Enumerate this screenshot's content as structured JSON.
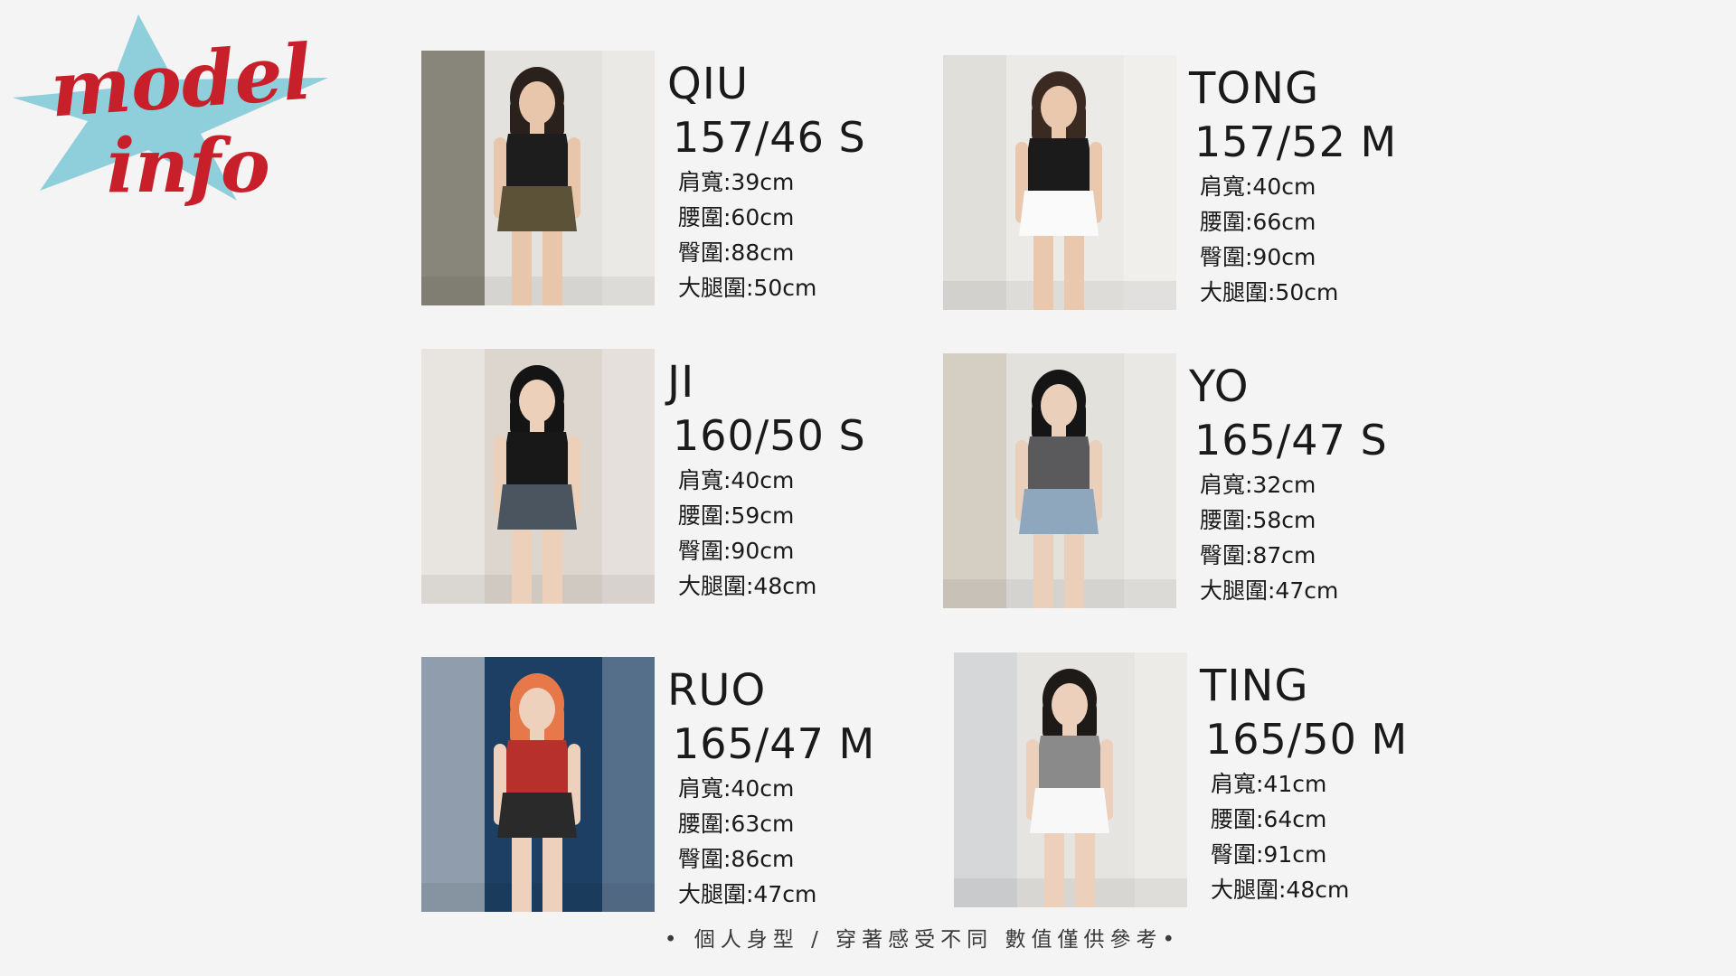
{
  "logo": {
    "line1": "model",
    "line2": "info",
    "star_color": "#8fcfdc",
    "text_color": "#c7202a"
  },
  "models": [
    {
      "name": "QIU",
      "size": "157/46 S",
      "measurements": [
        "肩寬:39cm",
        "腰圍:60cm",
        "臀圍:88cm",
        "大腿圍:50cm"
      ],
      "photo_palette": {
        "wall": "#e4e2de",
        "top": "#1d1d1d",
        "bottom": "#5b5238",
        "accent": "#3c3a2a",
        "hair": "#2a211c",
        "skin": "#e8c6ac"
      }
    },
    {
      "name": "TONG",
      "size": "157/52 M",
      "measurements": [
        "肩寬:40cm",
        "腰圍:66cm",
        "臀圍:90cm",
        "大腿圍:50cm"
      ],
      "photo_palette": {
        "wall": "#eceae6",
        "top": "#1b1b1b",
        "bottom": "#fafafa",
        "accent": "#d9d6d0",
        "hair": "#3a2a22",
        "skin": "#e9c8ae"
      }
    },
    {
      "name": "JI",
      "size": "160/50 S",
      "measurements": [
        "肩寬:40cm",
        "腰圍:59cm",
        "臀圍:90cm",
        "大腿圍:48cm"
      ],
      "photo_palette": {
        "wall": "#dcd6cf",
        "top": "#181818",
        "bottom": "#4b5560",
        "accent": "#f3f1ee",
        "hair": "#141414",
        "skin": "#ecd0ba"
      }
    },
    {
      "name": "YO",
      "size": "165/47 S",
      "measurements": [
        "肩寬:32cm",
        "腰圍:58cm",
        "臀圍:87cm",
        "大腿圍:47cm"
      ],
      "photo_palette": {
        "wall": "#e3e1dc",
        "top": "#5a5a5c",
        "bottom": "#8fa7bd",
        "accent": "#c9bfae",
        "hair": "#151515",
        "skin": "#ead0bb"
      }
    },
    {
      "name": "RUO",
      "size": "165/47 M",
      "measurements": [
        "肩寬:40cm",
        "腰圍:63cm",
        "臀圍:86cm",
        "大腿圍:47cm"
      ],
      "photo_palette": {
        "wall": "#1d3f63",
        "top": "#b8302c",
        "bottom": "#2a2a2a",
        "accent": "#ecebea",
        "hair": "#e6784a",
        "skin": "#edd1bd"
      }
    },
    {
      "name": "TING",
      "size": "165/50 M",
      "measurements": [
        "肩寬:41cm",
        "腰圍:64cm",
        "臀圍:91cm",
        "大腿圍:48cm"
      ],
      "photo_palette": {
        "wall": "#e6e4e0",
        "top": "#8a8a8a",
        "bottom": "#f8f8f8",
        "accent": "#c8ccd2",
        "hair": "#1e1a18",
        "skin": "#ecd0bb"
      }
    }
  ],
  "footer": {
    "note": "• 個人身型 / 穿著感受不同 數值僅供參考•"
  }
}
